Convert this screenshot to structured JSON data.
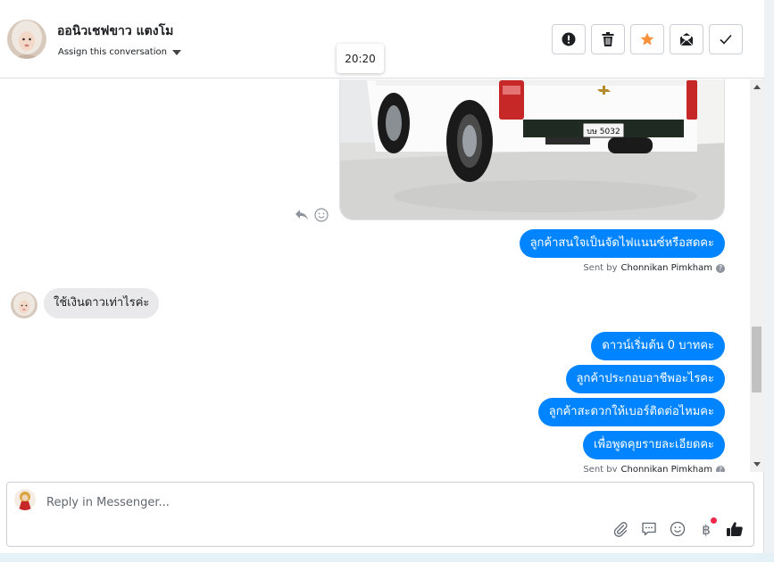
{
  "header": {
    "contact_name": "ออนิวเชฟขาว แตงโม",
    "assign_label": "Assign this conversation",
    "tooltip_time": "20:20",
    "actions": [
      {
        "name": "mark-spam-button",
        "icon": "exclamation-circle-icon"
      },
      {
        "name": "delete-button",
        "icon": "trash-icon"
      },
      {
        "name": "star-button",
        "icon": "star-icon",
        "color": "#f7923a"
      },
      {
        "name": "mark-unread-button",
        "icon": "envelope-icon"
      },
      {
        "name": "mark-done-button",
        "icon": "checkmark-icon"
      }
    ]
  },
  "thread": {
    "outgoing_1": [
      "ลูกค้าสนใจเป็นจัดไฟแนนซ์หรือสดคะ"
    ],
    "sent_by_1": {
      "prefix": "Sent by",
      "name": "Chonnikan Pimkham"
    },
    "incoming_1": "ใช้เงินดาวเท่าไรค่ะ",
    "outgoing_2": [
      "ดาวน์เริ่มต้น 0 บาทคะ",
      "ลูกค้าประกอบอาชีพอะไรคะ",
      "ลูกค้าสะดวกให้เบอร์ติดต่อไหมคะ",
      "เพื่อพูดคุยรายละเอียดคะ"
    ],
    "sent_by_2": {
      "prefix": "Sent by",
      "name": "Chonnikan Pimkham"
    },
    "photo": {
      "plate_text": "บษ 5032",
      "alt": "white-pickup-truck-rear"
    }
  },
  "composer": {
    "placeholder": "Reply in Messenger...",
    "tools": [
      "paperclip-icon",
      "saved-reply-icon",
      "emoji-icon",
      "baht-payment-icon",
      "thumbs-up-icon"
    ]
  },
  "colors": {
    "accent": "#0084ff",
    "incoming_bubble": "#e9e9eb",
    "star": "#f7923a",
    "notification": "#f02849"
  }
}
